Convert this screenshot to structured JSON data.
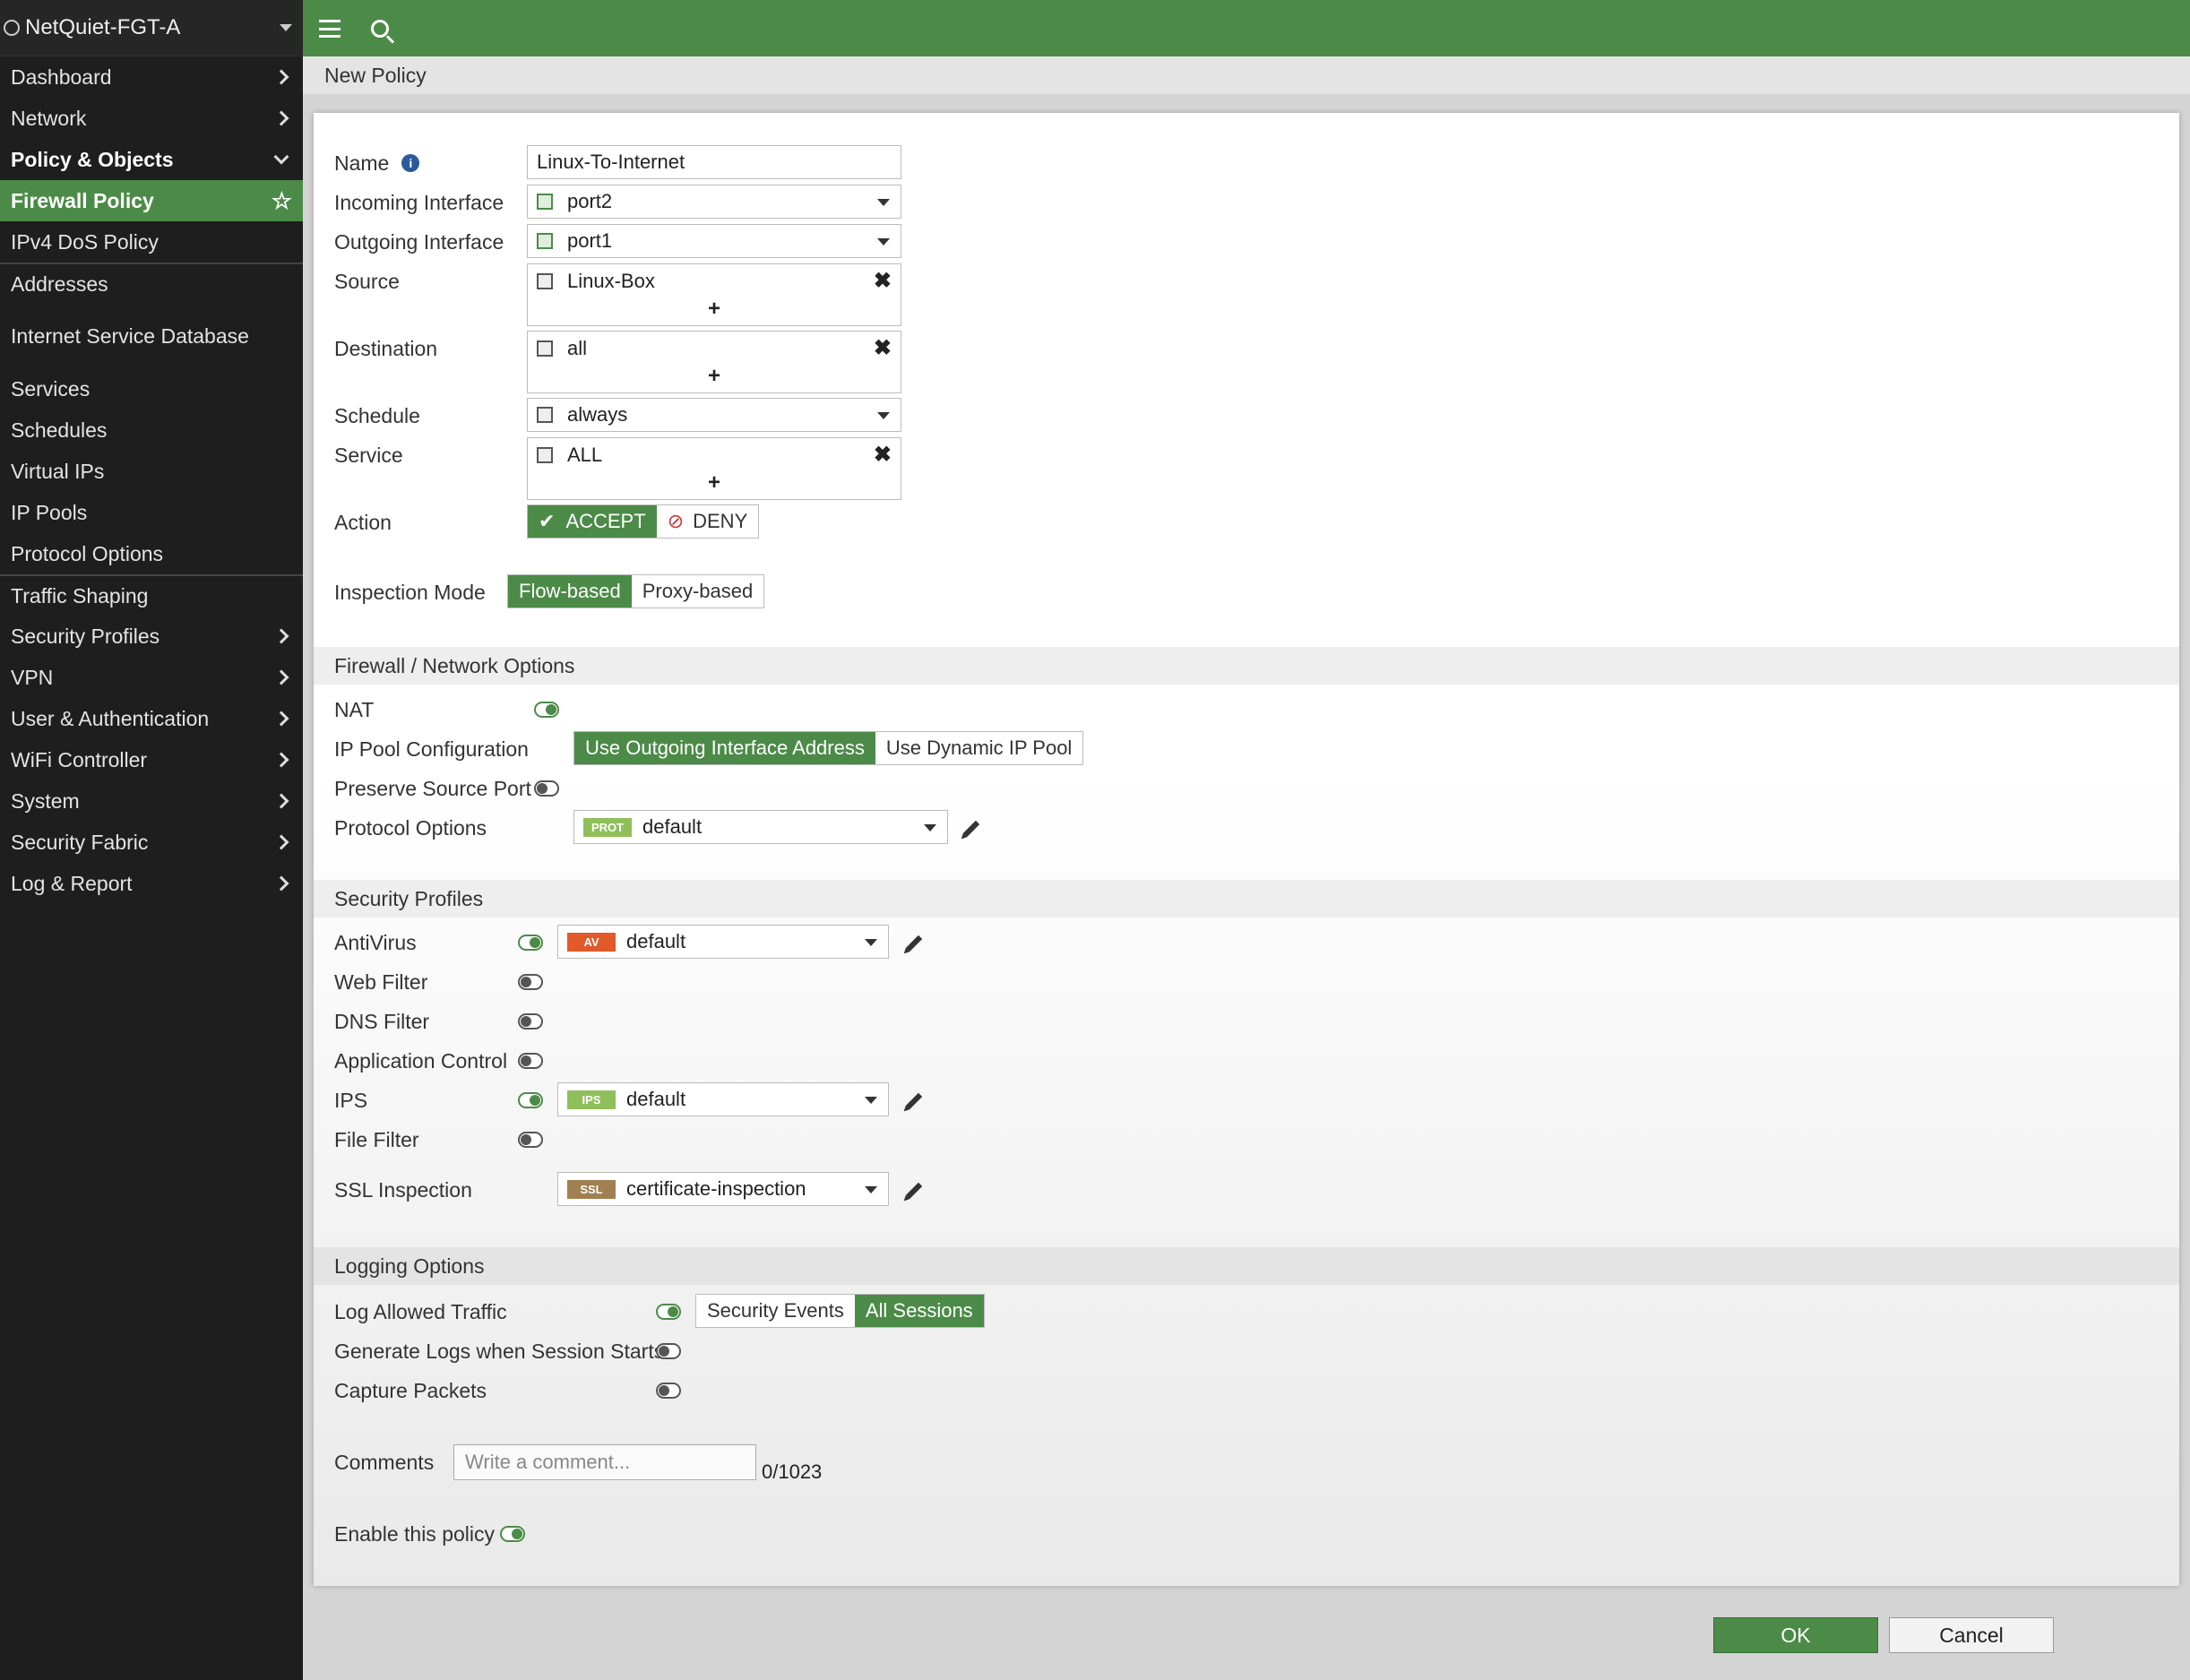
{
  "sidebar": {
    "hostname": "NetQuiet-FGT-A",
    "items": [
      {
        "label": "Dashboard"
      },
      {
        "label": "Network"
      },
      {
        "label": "Policy & Objects"
      },
      {
        "label": "Firewall Policy"
      },
      {
        "label": "IPv4 DoS Policy"
      },
      {
        "label": "Addresses"
      },
      {
        "label": "Internet Service Database"
      },
      {
        "label": "Services"
      },
      {
        "label": "Schedules"
      },
      {
        "label": "Virtual IPs"
      },
      {
        "label": "IP Pools"
      },
      {
        "label": "Protocol Options"
      },
      {
        "label": "Traffic Shaping"
      },
      {
        "label": "Security Profiles"
      },
      {
        "label": "VPN"
      },
      {
        "label": "User & Authentication"
      },
      {
        "label": "WiFi Controller"
      },
      {
        "label": "System"
      },
      {
        "label": "Security Fabric"
      },
      {
        "label": "Log & Report"
      }
    ]
  },
  "breadcrumb": "New Policy",
  "form": {
    "name_label": "Name",
    "name_value": "Linux-To-Internet",
    "incoming_label": "Incoming Interface",
    "incoming_value": "port2",
    "outgoing_label": "Outgoing Interface",
    "outgoing_value": "port1",
    "source_label": "Source",
    "source_value": "Linux-Box",
    "destination_label": "Destination",
    "destination_value": "all",
    "schedule_label": "Schedule",
    "schedule_value": "always",
    "service_label": "Service",
    "service_value": "ALL",
    "plus": "+",
    "remove": "✖",
    "action_label": "Action",
    "accept": "ACCEPT",
    "deny": "DENY",
    "inspection_label": "Inspection Mode",
    "flow": "Flow-based",
    "proxy": "Proxy-based"
  },
  "fw": {
    "title": "Firewall / Network Options",
    "nat": "NAT",
    "ippool_label": "IP Pool Configuration",
    "use_outgoing": "Use Outgoing Interface Address",
    "use_dynamic": "Use Dynamic IP Pool",
    "preserve": "Preserve Source Port",
    "protocol_label": "Protocol Options",
    "protocol_badge": "PROT",
    "protocol_value": "default"
  },
  "sec": {
    "title": "Security Profiles",
    "antivirus": "AntiVirus",
    "av_badge": "AV",
    "av_value": "default",
    "webfilter": "Web Filter",
    "dnsfilter": "DNS Filter",
    "appcontrol": "Application Control",
    "ips": "IPS",
    "ips_badge": "IPS",
    "ips_value": "default",
    "filefilter": "File Filter",
    "ssl": "SSL Inspection",
    "ssl_badge": "SSL",
    "ssl_value": "certificate-inspection"
  },
  "log": {
    "title": "Logging Options",
    "allowed": "Log Allowed Traffic",
    "security_events": "Security Events",
    "all_sessions": "All Sessions",
    "session_start": "Generate Logs when Session Starts",
    "capture": "Capture Packets",
    "comments_label": "Comments",
    "comments_placeholder": "Write a comment...",
    "counter": "0/1023",
    "enable": "Enable this policy"
  },
  "footer": {
    "ok": "OK",
    "cancel": "Cancel"
  },
  "colors": {
    "accent": "#4b8b47",
    "sidebar": "#1e1e1e",
    "av_badge": "#e05a2a",
    "ips_badge": "#8fbf5a",
    "ssl_badge": "#a08050"
  }
}
